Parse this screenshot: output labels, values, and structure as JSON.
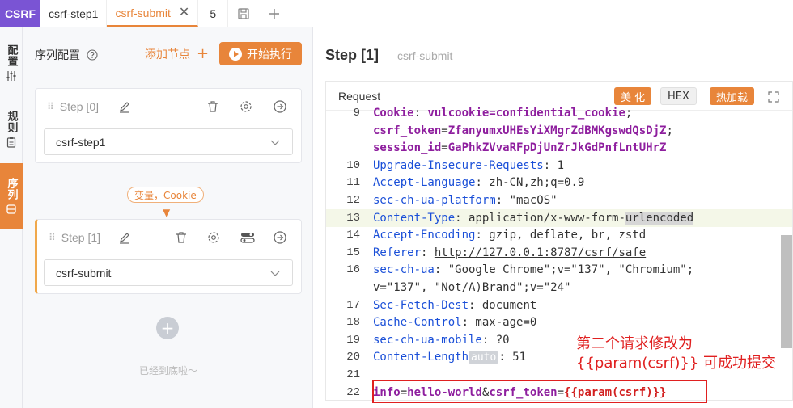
{
  "tabbar": {
    "brand": "CSRF",
    "tabs": [
      {
        "label": "csrf-step1"
      },
      {
        "label": "csrf-submit",
        "close": "✕"
      },
      {
        "label": "5"
      }
    ],
    "icons": [
      "save-icon",
      "plus-icon"
    ]
  },
  "rail": {
    "items": [
      {
        "label": "配置",
        "icon": "sliders-icon"
      },
      {
        "label": "规则",
        "icon": "clipboard-icon"
      },
      {
        "label": "序列",
        "icon": "sequence-icon"
      }
    ]
  },
  "panel": {
    "title": "序列配置",
    "add_node": "添加节点",
    "run_label": "开始执行",
    "steps": [
      {
        "title": "Step [0]",
        "value": "csrf-step1"
      },
      {
        "title": "Step [1]",
        "value": "csrf-submit"
      }
    ],
    "connector_tag": "变量，Cookie",
    "end_text": "已经到底啦～"
  },
  "main": {
    "title": "Step [1]",
    "subtitle": "csrf-submit",
    "request_label": "Request",
    "buttons": {
      "beautify": "美 化",
      "hex": "HEX",
      "hot_reload": "热加载"
    }
  },
  "code": {
    "lines": [
      {
        "n": "9",
        "parts": [
          {
            "c": "kp",
            "t": "Cookie"
          },
          {
            "c": "txt",
            "t": ": "
          },
          {
            "c": "kp",
            "t": "vulcookie=confidential_cookie"
          },
          {
            "c": "txt",
            "t": ";"
          }
        ]
      },
      {
        "n": "",
        "parts": [
          {
            "c": "kp",
            "t": "csrf_token"
          },
          {
            "c": "txt",
            "t": "="
          },
          {
            "c": "kp",
            "t": "ZfanyumxUHEsYiXMgrZdBMKgswdQsDjZ"
          },
          {
            "c": "txt",
            "t": "; "
          }
        ]
      },
      {
        "n": "",
        "parts": [
          {
            "c": "kp",
            "t": "session_id"
          },
          {
            "c": "txt",
            "t": "="
          },
          {
            "c": "kp",
            "t": "GaPhkZVvaRFpDjUnZrJkGdPnfLntUHrZ"
          }
        ]
      },
      {
        "n": "10",
        "parts": [
          {
            "c": "kb",
            "t": "Upgrade-Insecure-Requests"
          },
          {
            "c": "txt",
            "t": ": 1"
          }
        ]
      },
      {
        "n": "11",
        "parts": [
          {
            "c": "kb",
            "t": "Accept-Language"
          },
          {
            "c": "txt",
            "t": ": zh-CN,zh;q=0.9"
          }
        ]
      },
      {
        "n": "12",
        "parts": [
          {
            "c": "kb",
            "t": "sec-ch-ua-platform"
          },
          {
            "c": "txt",
            "t": ": \"macOS\""
          }
        ]
      },
      {
        "n": "13",
        "hl": true,
        "parts": [
          {
            "c": "kb",
            "t": "Content-Type"
          },
          {
            "c": "txt",
            "t": ": application/x-www-form-"
          },
          {
            "c": "txt mark",
            "t": "urlencoded"
          }
        ]
      },
      {
        "n": "14",
        "parts": [
          {
            "c": "kb",
            "t": "Accept-Encoding"
          },
          {
            "c": "txt",
            "t": ": gzip, deflate, br, zstd"
          }
        ]
      },
      {
        "n": "15",
        "parts": [
          {
            "c": "kb",
            "t": "Referer"
          },
          {
            "c": "txt",
            "t": ": "
          },
          {
            "c": "txt u",
            "t": "http://127.0.0.1:8787/csrf/safe"
          }
        ]
      },
      {
        "n": "16",
        "parts": [
          {
            "c": "kb",
            "t": "sec-ch-ua"
          },
          {
            "c": "txt",
            "t": ": \"Google Chrome\";v=\"137\", \"Chromium\";"
          }
        ]
      },
      {
        "n": "",
        "parts": [
          {
            "c": "txt",
            "t": "v=\"137\", \"Not/A)Brand\";v=\"24\""
          }
        ]
      },
      {
        "n": "17",
        "parts": [
          {
            "c": "kb",
            "t": "Sec-Fetch-Dest"
          },
          {
            "c": "txt",
            "t": ": document"
          }
        ]
      },
      {
        "n": "18",
        "parts": [
          {
            "c": "kb",
            "t": "Cache-Control"
          },
          {
            "c": "txt",
            "t": ": max-age=0"
          }
        ]
      },
      {
        "n": "19",
        "parts": [
          {
            "c": "kb",
            "t": "sec-ch-ua-mobile"
          },
          {
            "c": "txt",
            "t": ": ?0"
          }
        ]
      },
      {
        "n": "20",
        "parts": [
          {
            "c": "kb",
            "t": "Content-Length"
          },
          {
            "c": "auto",
            "t": "auto"
          },
          {
            "c": "txt",
            "t": ": 51"
          }
        ]
      },
      {
        "n": "21",
        "parts": []
      },
      {
        "n": "22",
        "parts": [
          {
            "c": "kp",
            "t": "info"
          },
          {
            "c": "txt",
            "t": "="
          },
          {
            "c": "kp",
            "t": "hello-world"
          },
          {
            "c": "txt",
            "t": "&"
          },
          {
            "c": "kp",
            "t": "csrf_token"
          },
          {
            "c": "txt",
            "t": "="
          },
          {
            "c": "red",
            "t": "{{param(csrf)}}"
          }
        ]
      }
    ]
  },
  "annotation": {
    "line1": "第二个请求修改为",
    "line2": "{{param(csrf)}} 可成功提交"
  },
  "colors": {
    "accent": "#e8853a",
    "brand": "#7a54d4",
    "annotation": "#e02020"
  }
}
